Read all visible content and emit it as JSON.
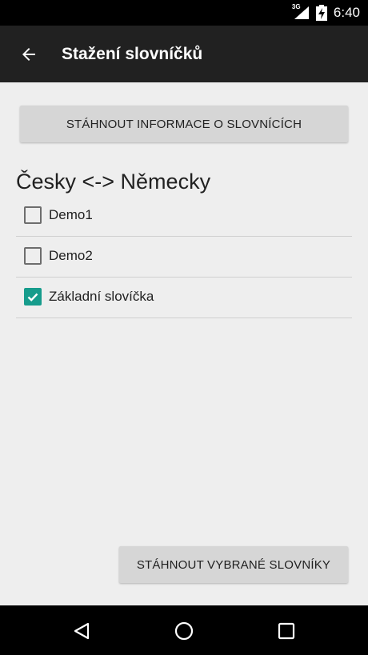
{
  "status_bar": {
    "network": "3G",
    "time": "6:40"
  },
  "app_bar": {
    "title": "Stažení slovníčků"
  },
  "actions": {
    "download_info": "STÁHNOUT INFORMACE O SLOVNÍCÍCH",
    "download_selected": "STÁHNOUT VYBRANÉ SLOVNÍKY"
  },
  "section": {
    "title": "Česky <-> Německy",
    "items": [
      {
        "label": "Demo1",
        "checked": false
      },
      {
        "label": "Demo2",
        "checked": false
      },
      {
        "label": "Základní slovíčka",
        "checked": true
      }
    ]
  },
  "colors": {
    "accent": "#169c8c",
    "app_bar": "#212121",
    "background": "#eeeeee",
    "button": "#d6d6d6"
  }
}
